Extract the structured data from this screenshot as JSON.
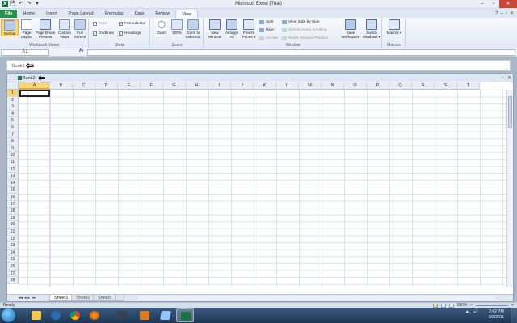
{
  "window": {
    "title": "Microsoft Excel (Trial)",
    "minimize": "–",
    "maximize": "▫",
    "close": "✕"
  },
  "qat": {
    "logo": "X",
    "save": "💾",
    "undo": "↶",
    "redo": "↷",
    "more": "▾"
  },
  "tabs": [
    {
      "label": "File"
    },
    {
      "label": "Home"
    },
    {
      "label": "Insert"
    },
    {
      "label": "Page Layout"
    },
    {
      "label": "Formulas"
    },
    {
      "label": "Data"
    },
    {
      "label": "Review"
    },
    {
      "label": "View"
    }
  ],
  "tab_icons": {
    "help": "?",
    "min": "–",
    "restore": "▫",
    "close": "✕"
  },
  "ribbon": {
    "workbook_views": {
      "label": "Workbook Views",
      "normal": "Normal",
      "page_layout": "Page Layout",
      "page_break": "Page Break Preview",
      "custom_views": "Custom Views",
      "full_screen": "Full Screen"
    },
    "show": {
      "label": "Show",
      "ruler": "Ruler",
      "gridlines": "Gridlines",
      "formula_bar": "Formula Bar",
      "headings": "Headings",
      "check": "✓"
    },
    "zoom": {
      "label": "Zoom",
      "zoom": "Zoom",
      "hundred": "100%",
      "to_selection": "Zoom to Selection"
    },
    "window": {
      "label": "Window",
      "new_window": "New Window",
      "arrange_all": "Arrange All",
      "freeze_panes": "Freeze Panes ▾",
      "split": "Split",
      "hide": "Hide",
      "unhide": "Unhide",
      "side_by_side": "View Side by Side",
      "sync_scroll": "Synchronous Scrolling",
      "reset_pos": "Reset Window Position",
      "save_workspace": "Save Workspace",
      "switch_windows": "Switch Windows ▾"
    },
    "macros": {
      "label": "Macros",
      "macros": "Macros ▾"
    }
  },
  "formula_bar": {
    "name_box": "A1",
    "fx": "fx"
  },
  "minimized_book": {
    "title": "Book1"
  },
  "workbook": {
    "title": "Book2",
    "columns": [
      "A",
      "B",
      "C",
      "D",
      "E",
      "F",
      "G",
      "H",
      "I",
      "J",
      "K",
      "L",
      "M",
      "N",
      "O",
      "P",
      "Q",
      "R",
      "S",
      "T"
    ],
    "rows": [
      "1",
      "2",
      "3",
      "4",
      "5",
      "6",
      "7",
      "8",
      "9",
      "10",
      "11",
      "12",
      "13",
      "14",
      "15",
      "16",
      "17",
      "18",
      "19",
      "20",
      "21",
      "22",
      "23",
      "24",
      "25",
      "26",
      "27",
      "28"
    ],
    "sheets": [
      "Sheet1",
      "Sheet2",
      "Sheet3"
    ],
    "nav": [
      "◂◂",
      "◂",
      "▸",
      "▸▸"
    ]
  },
  "status": {
    "ready": "Ready",
    "zoom": "100%",
    "minus": "–",
    "plus": "+"
  },
  "taskbar": {
    "time": "2:42 PM",
    "date": "3/3/2011",
    "tray": [
      "▲",
      "🔊"
    ]
  },
  "colors": {
    "accent": "#2a8e4f",
    "selection": "#f7d57a",
    "taskbar": "#1d3756"
  }
}
